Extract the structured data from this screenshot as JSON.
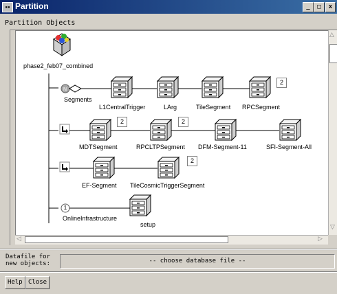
{
  "window": {
    "title": "Partition",
    "minimize_glyph": "_",
    "maximize_glyph": "□",
    "close_glyph": "x"
  },
  "section_label": "Partition Objects",
  "root": {
    "label": "phase2_feb07_combined"
  },
  "segments": {
    "label": "Segments",
    "nodes": [
      {
        "label": "L1CentralTrigger"
      },
      {
        "label": "LArg"
      },
      {
        "label": "TileSegment"
      },
      {
        "label": "RPCSegment",
        "badge": "2"
      }
    ]
  },
  "row2": {
    "nodes": [
      {
        "label": "MDTSegment",
        "badge": "2"
      },
      {
        "label": "RPCLTPSegment",
        "badge": "2"
      },
      {
        "label": "DFM-Segment-11"
      },
      {
        "label": "SFI-Segment-All"
      }
    ]
  },
  "row3": {
    "nodes": [
      {
        "label": "EF-Segment"
      },
      {
        "label": "TileCosmicTriggerSegment",
        "badge": "2"
      }
    ]
  },
  "online": {
    "label": "OnlineInfrastructure",
    "marker": "1",
    "nodes": [
      {
        "label": "setup"
      }
    ]
  },
  "datafile": {
    "label": "Datafile for\nnew objects:",
    "value": "-- choose database file --"
  },
  "buttons": {
    "help": "Help",
    "close": "Close"
  }
}
